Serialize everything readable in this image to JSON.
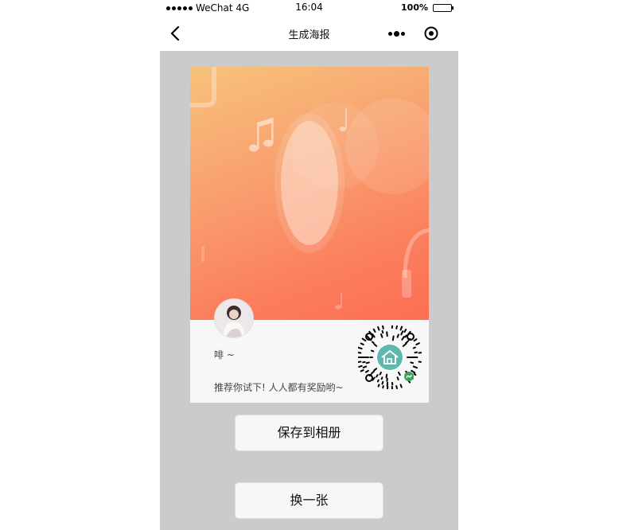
{
  "status_bar": {
    "carrier": "WeChat 4G",
    "time": "16:04",
    "battery": "100%"
  },
  "navbar": {
    "title": "生成海报"
  },
  "poster": {
    "nickname": "啡 ~",
    "tagline": "推荐你试下! 人人都有奖励哟~"
  },
  "buttons": {
    "save": "保存到相册",
    "change": "换一张"
  },
  "colors": {
    "poster_gradient_start": "#f7c27b",
    "poster_gradient_end": "#fc6e55",
    "qr_center": "#5fb8ad",
    "mini_program_badge": "#3aa15a",
    "page_background": "#cbcbcb"
  },
  "icons": {
    "back": "chevron-left-icon",
    "more": "more-dots-icon",
    "close": "target-circle-icon",
    "qr_center": "house-icon"
  }
}
